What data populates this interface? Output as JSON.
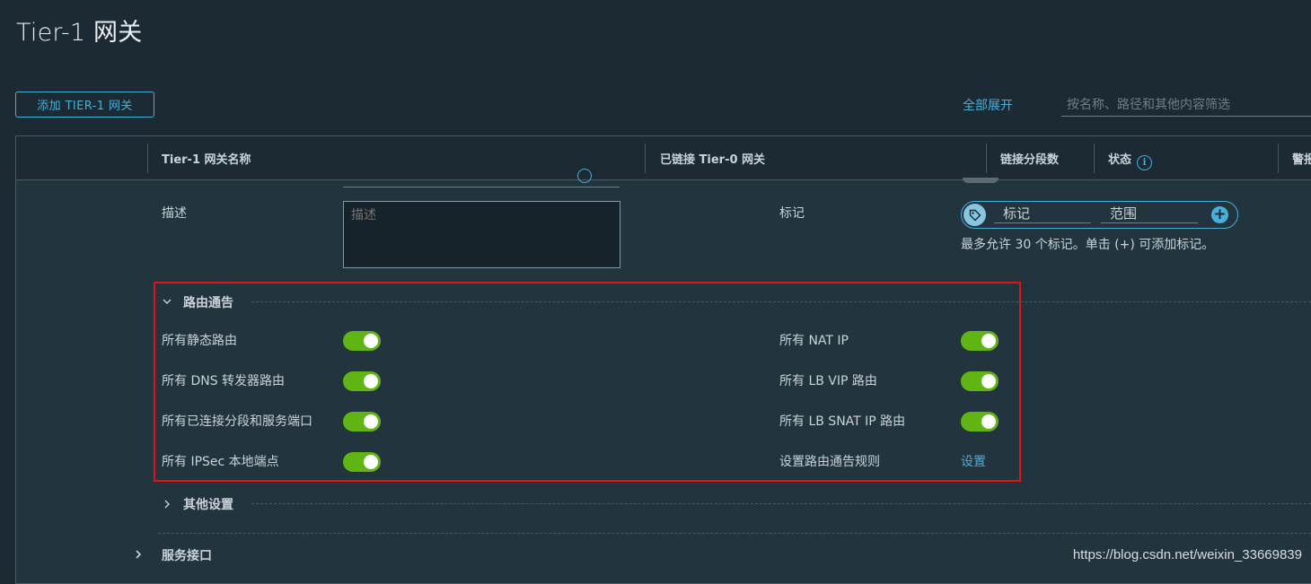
{
  "page": {
    "title": "Tier-1 网关"
  },
  "toolbar": {
    "add_button": "添加 TIER-1 网关",
    "expand_all": "全部展开",
    "filter_placeholder": "按名称、路径和其他内容筛选"
  },
  "columns": [
    "Tier-1 网关名称",
    "已链接 Tier-0 网关",
    "链接分段数",
    "状态",
    "警报"
  ],
  "form": {
    "description_label": "描述",
    "description_placeholder": "描述",
    "tags_label": "标记",
    "tag_placeholder": "标记",
    "scope_placeholder": "范围",
    "tags_hint": "最多允许 30 个标记。单击 (+) 可添加标记。"
  },
  "route_advertisement": {
    "title": "路由通告",
    "left": [
      {
        "label": "所有静态路由",
        "enabled": true
      },
      {
        "label": "所有 DNS 转发器路由",
        "enabled": true
      },
      {
        "label": "所有已连接分段和服务端口",
        "enabled": true
      },
      {
        "label": "所有 IPSec 本地端点",
        "enabled": true
      }
    ],
    "right": [
      {
        "label": "所有 NAT IP",
        "enabled": true
      },
      {
        "label": "所有 LB VIP 路由",
        "enabled": true
      },
      {
        "label": "所有 LB SNAT IP 路由",
        "enabled": true
      }
    ],
    "rules_label": "设置路由通告规则",
    "rules_link": "设置"
  },
  "other_settings": {
    "title": "其他设置"
  },
  "service_interfaces": {
    "title": "服务接口"
  },
  "watermark": "https://blog.csdn.net/weixin_33669839",
  "colors": {
    "accent": "#49afd9",
    "toggle_on": "#60b515",
    "highlight": "#e0131d",
    "background": "#1b2a33",
    "panel": "#22343e"
  },
  "icons": {
    "tag": "tag-icon",
    "add": "plus-circle-icon",
    "info": "info-icon",
    "expand": "chevron-right-icon",
    "collapse": "chevron-down-icon"
  }
}
